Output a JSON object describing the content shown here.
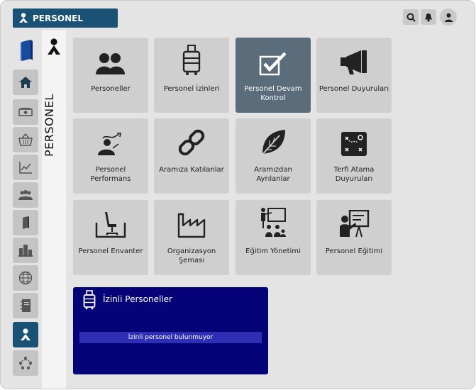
{
  "app": {
    "title": "PERSONEL"
  },
  "header_actions": [
    {
      "name": "search-icon"
    },
    {
      "name": "bell-icon"
    },
    {
      "name": "user-icon"
    }
  ],
  "sidebar": {
    "items": [
      {
        "name": "home",
        "icon": "home-icon",
        "active": false
      },
      {
        "name": "money",
        "icon": "money-icon",
        "active": false
      },
      {
        "name": "basket",
        "icon": "basket-icon",
        "active": false
      },
      {
        "name": "chart",
        "icon": "line-chart-icon",
        "active": false
      },
      {
        "name": "group",
        "icon": "group-icon",
        "active": false
      },
      {
        "name": "book",
        "icon": "book-icon",
        "active": false
      },
      {
        "name": "factory",
        "icon": "buildings-icon",
        "active": false
      },
      {
        "name": "globe",
        "icon": "globe-icon",
        "active": false
      },
      {
        "name": "notebook",
        "icon": "notebook-icon",
        "active": false
      },
      {
        "name": "personel",
        "icon": "person-icon",
        "active": true
      },
      {
        "name": "hierarchy",
        "icon": "hierarchy-icon",
        "active": false
      }
    ]
  },
  "section": {
    "label": "PERSONEL"
  },
  "tiles": [
    {
      "label": "Personeller",
      "icon": "people-icon",
      "selected": false
    },
    {
      "label": "Personel İzinleri",
      "icon": "luggage-icon",
      "selected": false
    },
    {
      "label": "Personel Devam Kontrol",
      "icon": "checkbox-icon",
      "selected": true
    },
    {
      "label": "Personel Duyuruları",
      "icon": "megaphone-icon",
      "selected": false
    },
    {
      "label": "Personel Performans",
      "icon": "performance-icon",
      "selected": false
    },
    {
      "label": "Aramıza Katılanlar",
      "icon": "link-icon",
      "selected": false
    },
    {
      "label": "Aramızdan Ayrılanlar",
      "icon": "leaf-icon",
      "selected": false
    },
    {
      "label": "Terfi Atama Duyuruları",
      "icon": "strategy-board-icon",
      "selected": false
    },
    {
      "label": "Personel Envanter",
      "icon": "office-chair-icon",
      "selected": false
    },
    {
      "label": "Organizasyon Şeması",
      "icon": "factory-icon",
      "selected": false
    },
    {
      "label": "Eğitim Yönetimi",
      "icon": "presentation-group-icon",
      "selected": false
    },
    {
      "label": "Personel Eğitimi",
      "icon": "teacher-board-icon",
      "selected": false
    }
  ],
  "panel": {
    "title": "İzinli Personeller",
    "icon": "luggage-icon",
    "message": "İzinli personel bulunmuyor"
  },
  "colors": {
    "brand": "#1a5276",
    "panel_bg": "#040478",
    "panel_message_bg": "#2f2fb5",
    "tile_bg": "#cfcfcf",
    "tile_selected_bg": "#5b6d7b"
  }
}
